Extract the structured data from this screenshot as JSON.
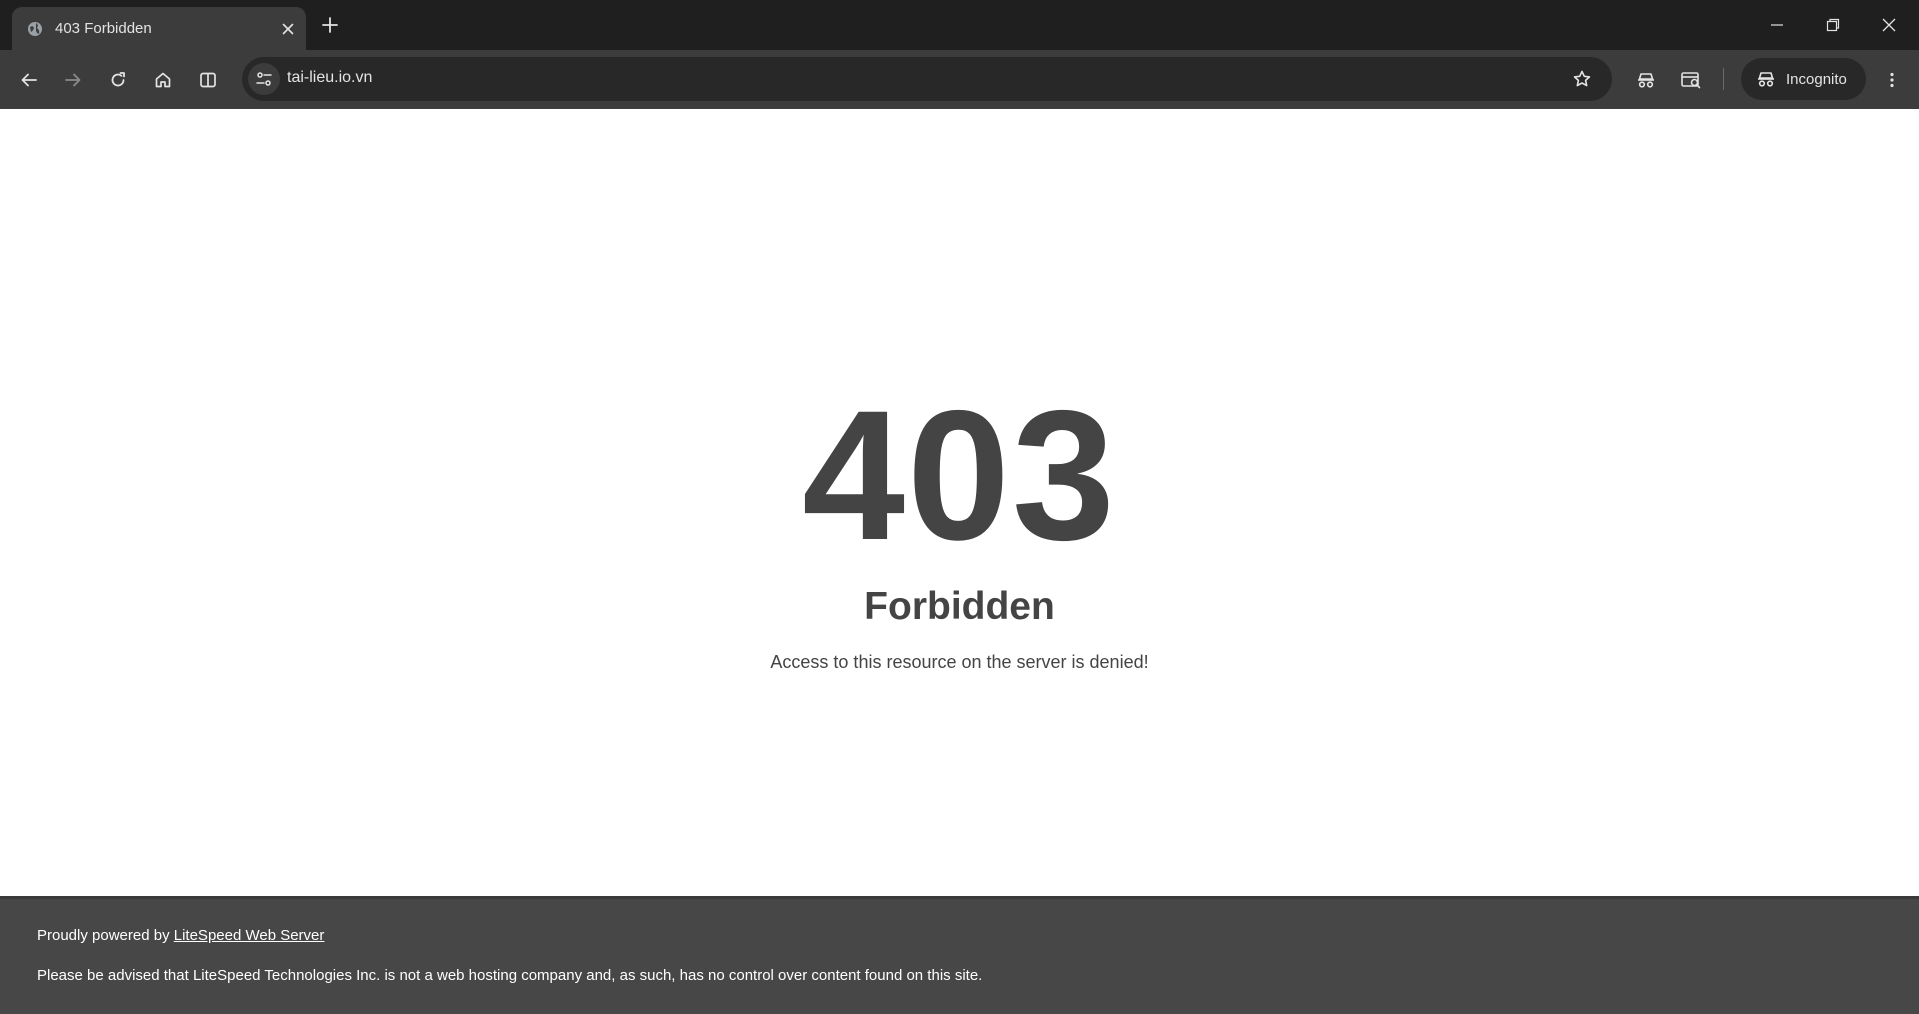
{
  "browser": {
    "tab": {
      "title": "403 Forbidden",
      "favicon": "globe-icon"
    },
    "omnibox": {
      "url": "tai-lieu.io.vn"
    },
    "profile": {
      "label": "Incognito"
    },
    "colors": {
      "tabstrip": "#1f1f1f",
      "toolbar": "#3c3c3c",
      "omnibox": "#282828"
    }
  },
  "page": {
    "code": "403",
    "title": "Forbidden",
    "description": "Access to this resource on the server is denied!",
    "footer": {
      "powered_prefix": "Proudly powered by ",
      "powered_link": "LiteSpeed Web Server",
      "disclaimer": "Please be advised that LiteSpeed Technologies Inc. is not a web hosting company and, as such, has no control over content found on this site."
    },
    "colors": {
      "text": "#444444",
      "footer_bg": "#474747"
    }
  }
}
